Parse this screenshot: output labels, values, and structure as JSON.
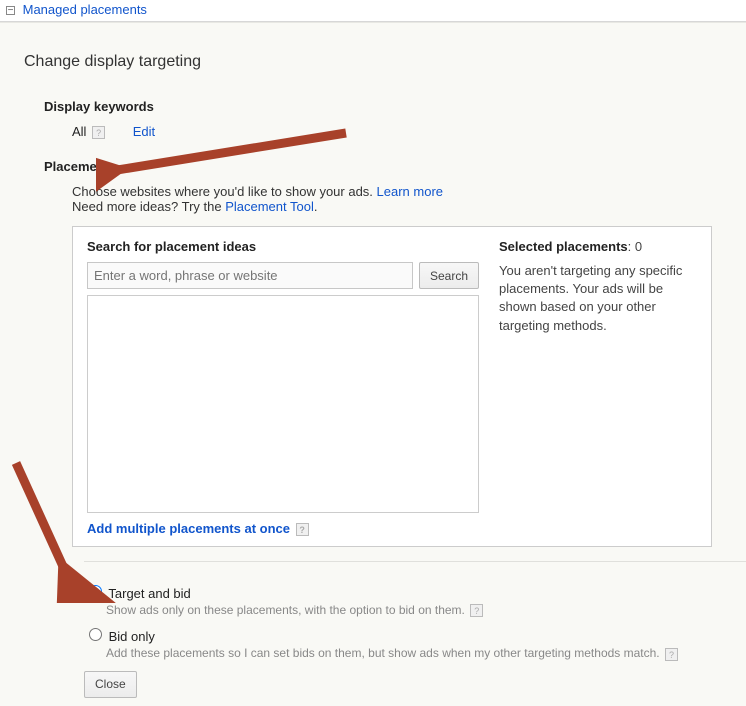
{
  "top": {
    "expand": "−",
    "link": "Managed placements"
  },
  "page_title": "Change display targeting",
  "display_keywords": {
    "title": "Display keywords",
    "all": "All",
    "edit": "Edit"
  },
  "placements": {
    "title": "Placements",
    "line1a": "Choose websites where you'd like to show your ads. ",
    "learn_more": "Learn more",
    "line2a": "Need more ideas? Try the ",
    "placement_tool": "Placement Tool",
    "period": "."
  },
  "search": {
    "heading": "Search for placement ideas",
    "placeholder": "Enter a word, phrase or website",
    "button": "Search",
    "add_multiple": "Add multiple placements at once"
  },
  "selected": {
    "heading_a": "Selected placements",
    "heading_b": ": 0",
    "desc": "You aren't targeting any specific placements. Your ads will be shown based on your other targeting methods."
  },
  "options": {
    "o1_label": "Target and bid",
    "o1_desc": "Show ads only on these placements, with the option to bid on them.",
    "o2_label": "Bid only",
    "o2_desc": "Add these placements so I can set bids on them, but show ads when my other targeting methods match."
  },
  "close": "Close",
  "help_glyph": "?"
}
